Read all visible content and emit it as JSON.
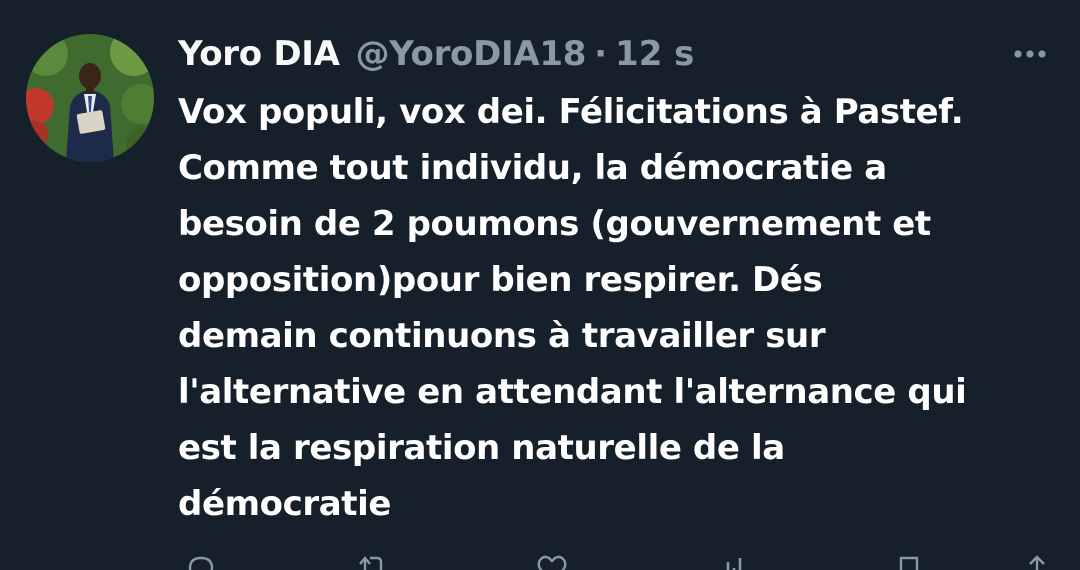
{
  "tweet": {
    "author_name": "Yoro DIA",
    "handle": "@YoroDIA18",
    "separator": "·",
    "time": "12 s",
    "text_lines": [
      "Vox populi, vox dei. Félicitations à Pastef.",
      "Comme tout individu, la démocratie a",
      "besoin de 2 poumons (gouvernement et",
      "opposition)pour bien respirer.  Dés",
      "demain continuons à travailler sur",
      "l'alternative en attendant l'alternance qui",
      "est la respiration naturelle de la",
      "démocratie"
    ]
  },
  "icons": {
    "more": "more-horizontal-icon",
    "reply": "reply-icon",
    "retweet": "retweet-icon",
    "like": "like-icon",
    "views": "views-icon",
    "bookmark": "bookmark-icon",
    "share": "share-icon"
  },
  "colors": {
    "background": "#15202b",
    "primary_text": "#f7f9f9",
    "secondary_text": "#8b98a5"
  }
}
